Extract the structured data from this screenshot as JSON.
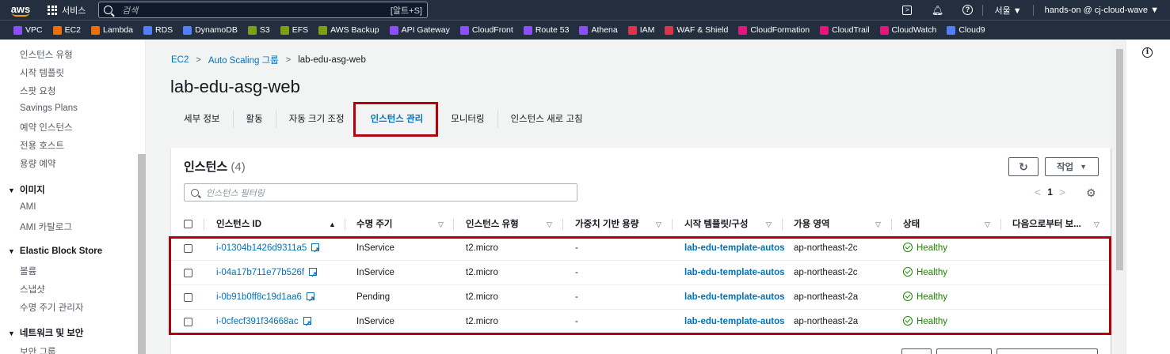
{
  "topnav": {
    "logo": "aws",
    "services": "서비스",
    "search_placeholder": "검색",
    "search_shortcut": "[알트+S]",
    "region": "서울 ▼",
    "account": "hands-on @ cj-cloud-wave ▼"
  },
  "favorites": [
    {
      "label": "VPC",
      "color": "#8c4fff"
    },
    {
      "label": "EC2",
      "color": "#ed7100"
    },
    {
      "label": "Lambda",
      "color": "#ed7100"
    },
    {
      "label": "RDS",
      "color": "#527fff"
    },
    {
      "label": "DynamoDB",
      "color": "#527fff"
    },
    {
      "label": "S3",
      "color": "#7aa116"
    },
    {
      "label": "EFS",
      "color": "#7aa116"
    },
    {
      "label": "AWS Backup",
      "color": "#7aa116"
    },
    {
      "label": "API Gateway",
      "color": "#8c4fff"
    },
    {
      "label": "CloudFront",
      "color": "#8c4fff"
    },
    {
      "label": "Route 53",
      "color": "#8c4fff"
    },
    {
      "label": "Athena",
      "color": "#8c4fff"
    },
    {
      "label": "IAM",
      "color": "#dd344c"
    },
    {
      "label": "WAF & Shield",
      "color": "#dd344c"
    },
    {
      "label": "CloudFormation",
      "color": "#e7157b"
    },
    {
      "label": "CloudTrail",
      "color": "#e7157b"
    },
    {
      "label": "CloudWatch",
      "color": "#e7157b"
    },
    {
      "label": "Cloud9",
      "color": "#527fff"
    }
  ],
  "sidebar": {
    "items_top": [
      "인스턴스 유형",
      "시작 템플릿",
      "스팟 요청",
      "Savings Plans",
      "예약 인스턴스",
      "전용 호스트",
      "용량 예약"
    ],
    "section_images": "이미지",
    "items_images": [
      "AMI",
      "AMI 카탈로그"
    ],
    "section_ebs": "Elastic Block Store",
    "items_ebs": [
      "볼륨",
      "스냅샷",
      "수명 주기 관리자"
    ],
    "section_network": "네트워크 및 보안",
    "items_network": [
      "보안 그룹"
    ]
  },
  "breadcrumb": {
    "ec2": "EC2",
    "asg": "Auto Scaling 그룹",
    "current": "lab-edu-asg-web"
  },
  "page_title": "lab-edu-asg-web",
  "tabs": [
    "세부 정보",
    "활동",
    "자동 크기 조정",
    "인스턴스 관리",
    "모니터링",
    "인스턴스 새로 고침"
  ],
  "panel": {
    "title": "인스턴스",
    "count": "(4)",
    "action_label": "작업",
    "filter_placeholder": "인스턴스 필터링",
    "page": "1"
  },
  "columns": [
    "인스턴스 ID",
    "수명 주기",
    "인스턴스 유형",
    "가중치 기반 용량",
    "시작 템플릿/구성",
    "가용 영역",
    "상태",
    "다음으로부터 보..."
  ],
  "rows": [
    {
      "id": "i-01304b1426d9311a5",
      "lifecycle": "InService",
      "type": "t2.micro",
      "weight": "-",
      "template": "lab-edu-template-autos",
      "az": "ap-northeast-2c",
      "status": "Healthy"
    },
    {
      "id": "i-04a17b711e77b526f",
      "lifecycle": "InService",
      "type": "t2.micro",
      "weight": "-",
      "template": "lab-edu-template-autos",
      "az": "ap-northeast-2c",
      "status": "Healthy"
    },
    {
      "id": "i-0b91b0ff8c19d1aa6",
      "lifecycle": "Pending",
      "type": "t2.micro",
      "weight": "-",
      "template": "lab-edu-template-autos",
      "az": "ap-northeast-2a",
      "status": "Healthy"
    },
    {
      "id": "i-0cfecf391f34668ac",
      "lifecycle": "InService",
      "type": "t2.micro",
      "weight": "-",
      "template": "lab-edu-template-autos",
      "az": "ap-northeast-2a",
      "status": "Healthy"
    }
  ],
  "colors": {
    "nav_bg": "#232f3e",
    "link": "#0073bb",
    "healthy": "#1d8102",
    "highlight": "#b2000d"
  }
}
